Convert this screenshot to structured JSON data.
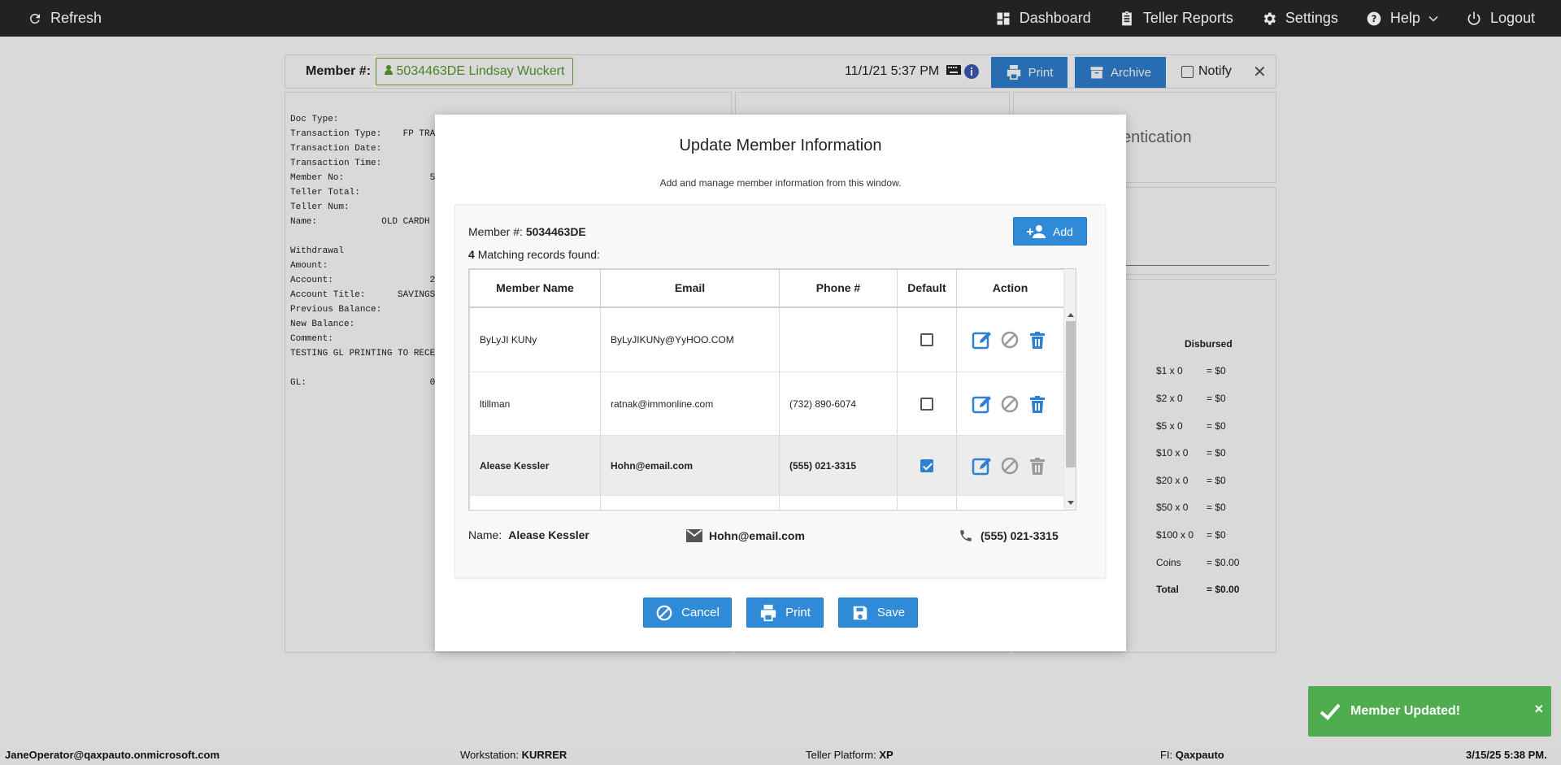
{
  "nav": {
    "refresh": "Refresh",
    "dashboard": "Dashboard",
    "teller_reports": "Teller Reports",
    "settings": "Settings",
    "help": "Help",
    "logout": "Logout"
  },
  "member_bar": {
    "label": "Member #:",
    "member": "5034463DE Lindsay Wuckert",
    "datetime": "11/1/21 5:37 PM",
    "print": "Print",
    "archive": "Archive",
    "notify": "Notify"
  },
  "receipt": {
    "lines": "Doc Type:\nTransaction Type:    FP TRA\nTransaction Date:\nTransaction Time:\nMember No:                5\nTeller Total:\nTeller Num:\nName:            OLD CARDH\n\nWithdrawal\nAmount:\nAccount:                  2\nAccount Title:      SAVINGS\nPrevious Balance:\nNew Balance:\nComment:\nTESTING GL PRINTING TO RECE\n\nGL:                       0"
  },
  "right_panel": {
    "auth_text": "entication",
    "disbursed_header": "Disbursed",
    "rows": [
      {
        "label": "$1 x 0",
        "value": "= $0"
      },
      {
        "label": "$2 x 0",
        "value": "= $0"
      },
      {
        "label": "$5 x 0",
        "value": "= $0"
      },
      {
        "label": "$10 x 0",
        "value": "= $0"
      },
      {
        "label": "$20 x 0",
        "value": "= $0"
      },
      {
        "label": "$50 x 0",
        "value": "= $0"
      },
      {
        "label": "$100 x 0",
        "value": "= $0"
      },
      {
        "label": "Coins",
        "value": "= $0.00"
      },
      {
        "label": "Total",
        "value": "= $0.00"
      }
    ]
  },
  "modal": {
    "title": "Update Member Information",
    "subtitle": "Add and manage member information from this window.",
    "member_label": "Member #:",
    "member_no": "5034463DE",
    "match_count": "4",
    "match_text": "Matching records found:",
    "add_label": "Add",
    "columns": [
      "Member Name",
      "Email",
      "Phone #",
      "Default",
      "Action"
    ],
    "rows": [
      {
        "name": "ByLyJI KUNy",
        "email": "ByLyJIKUNy@YyHOO.COM",
        "phone": "",
        "default": false
      },
      {
        "name": "ltillman",
        "email": "ratnak@immonline.com",
        "phone": "(732) 890-6074",
        "default": false
      },
      {
        "name": "Alease Kessler",
        "email": "Hohn@email.com",
        "phone": "(555) 021-3315",
        "default": true
      }
    ],
    "detail": {
      "name_label": "Name:",
      "name": "Alease Kessler",
      "email": "Hohn@email.com",
      "phone": "(555) 021-3315"
    },
    "buttons": {
      "cancel": "Cancel",
      "print": "Print",
      "save": "Save"
    }
  },
  "toast": {
    "message": "Member Updated!",
    "close": "×"
  },
  "status": {
    "user": "JaneOperator@qaxpauto.onmicrosoft.com",
    "workstation_label": "Workstation:",
    "workstation": "KURRER",
    "platform_label": "Teller Platform:",
    "platform": "XP",
    "fi_label": "FI:",
    "fi": "Qaxpauto",
    "datetime": "3/15/25 5:38 PM."
  },
  "colors": {
    "accent": "#2f8ad8",
    "success": "#4fac4f",
    "nav_bg": "#222222"
  }
}
